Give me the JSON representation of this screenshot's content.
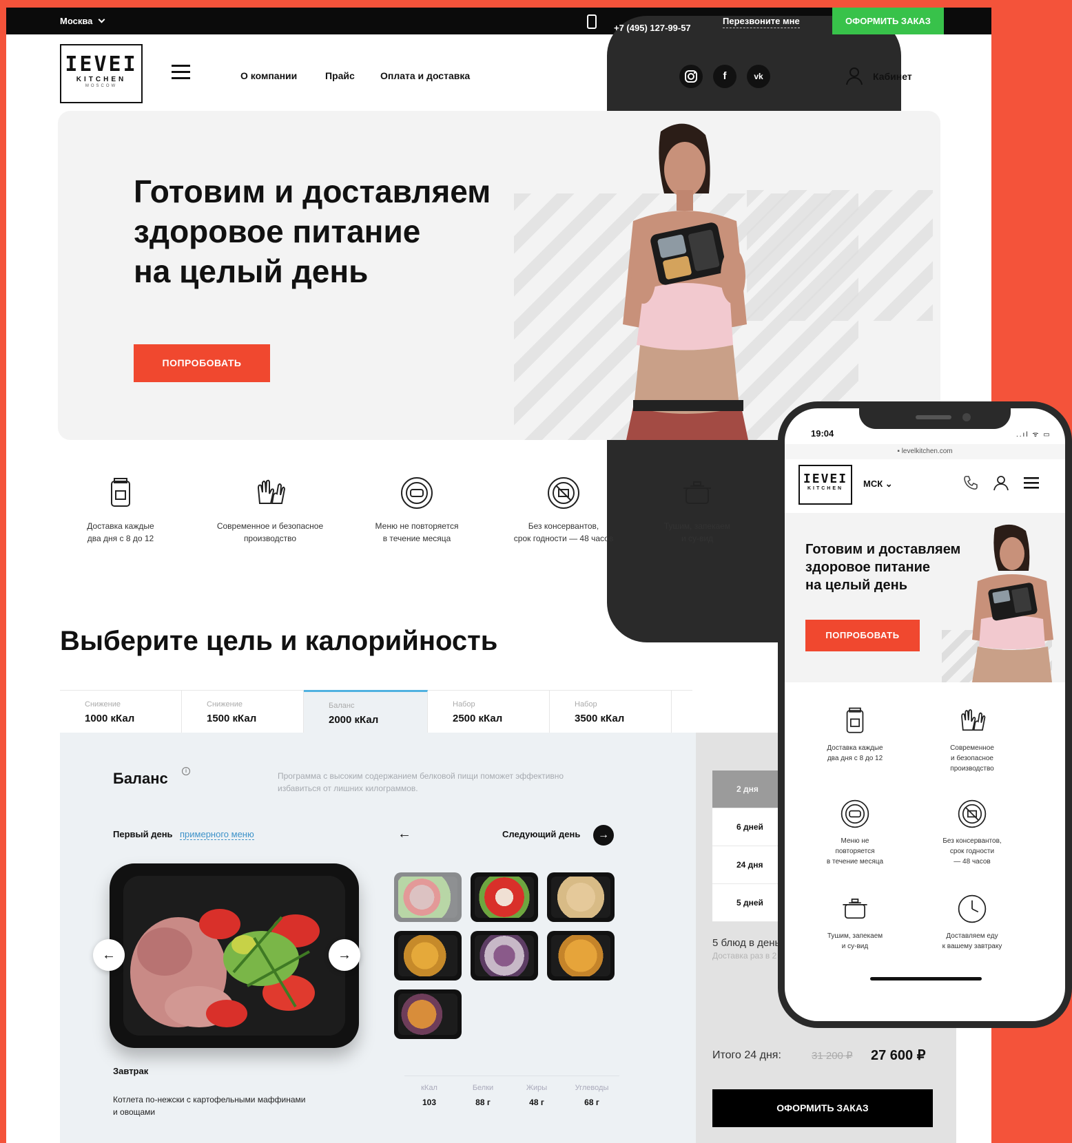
{
  "topbar": {
    "city": "Москва",
    "phone": "+7 (495) 127-99-57",
    "callback": "Перезвоните мне",
    "order": "ОФОРМИТЬ ЗАКАЗ"
  },
  "logo": {
    "line1": "IEVEI",
    "line2": "KITCHEN",
    "line3": "MOSCOW"
  },
  "nav": {
    "items": [
      "О компании",
      "Прайс",
      "Оплата и доставка"
    ]
  },
  "social": {
    "instagram": "instagram-icon",
    "facebook": "f",
    "vk": "vk"
  },
  "cabinet": "Кабинет",
  "hero": {
    "title_lines": [
      "Готовим и доставляем",
      "здоровое питание",
      "на целый день"
    ],
    "cta": "ПОПРОБОВАТЬ"
  },
  "features": [
    {
      "icon": "delivery-bag-icon",
      "text": [
        "Доставка каждые",
        "два дня с 8 до 12"
      ]
    },
    {
      "icon": "gloves-icon",
      "text": [
        "Современное и безопасное",
        "производство"
      ]
    },
    {
      "icon": "menu-plate-icon",
      "text": [
        "Меню не повторяется",
        "в течение месяца"
      ]
    },
    {
      "icon": "no-preservatives-icon",
      "text": [
        "Без консервантов,",
        "срок годности — 48 часов"
      ]
    },
    {
      "icon": "pot-icon",
      "text": [
        "Тушим, запекаем",
        "и су-вид"
      ]
    }
  ],
  "goal_section": {
    "title": "Выберите цель и калорийность",
    "tabs": [
      {
        "category": "Снижение",
        "kcal": "1000 кКал"
      },
      {
        "category": "Снижение",
        "kcal": "1500 кКал"
      },
      {
        "category": "Баланс",
        "kcal": "2000 кКал"
      },
      {
        "category": "Набор",
        "kcal": "2500 кКал"
      },
      {
        "category": "Набор",
        "kcal": "3500 кКал"
      }
    ],
    "active_tab": 2
  },
  "plan": {
    "title": "Баланс",
    "info": "i",
    "description": "Программа с высоким содержанием белковой пищи поможет эффективно избавиться от лишних килограммов.",
    "first_day": "Первый день",
    "menu_link": "примерного меню",
    "prev_arrow": "←",
    "next_day": "Следующий день",
    "next_arrow": "→",
    "carousel_prev": "←",
    "carousel_next": "→",
    "meal_name": "Завтрак",
    "meal_desc": "Котлета по-нежски с картофельными маффинами и овощами",
    "nutrition": [
      {
        "label": "кКал",
        "value": "103"
      },
      {
        "label": "Белки",
        "value": "88 г"
      },
      {
        "label": "Жиры",
        "value": "48 г"
      },
      {
        "label": "Углеводы",
        "value": "68 г"
      }
    ]
  },
  "order_side": {
    "days": [
      "2 дня",
      "6 дней",
      "24 дня",
      "5 дней"
    ],
    "selected_day": 0,
    "dishes": "5 блюд в день",
    "delivery_note": "Доставка раз в 2 дня",
    "total_label": "Итого 24 дня:",
    "old_price": "31 200 ₽",
    "new_price": "27 600 ₽",
    "order_button": "ОФОРМИТЬ ЗАКАЗ"
  },
  "mobile": {
    "time": "19:04",
    "status": "..ıl ᯤ ▭",
    "url": "levelkitchen.com",
    "city": "МСК",
    "hero_lines": [
      "Готовим и доставляем",
      "здоровое питание",
      "на целый день"
    ],
    "cta": "ПОПРОБОВАТЬ",
    "features": [
      {
        "icon": "delivery-bag-icon",
        "text": [
          "Доставка каждые",
          "два дня с 8 до 12"
        ]
      },
      {
        "icon": "gloves-icon",
        "text": [
          "Современное",
          "и безопасное",
          "производство"
        ]
      },
      {
        "icon": "menu-plate-icon",
        "text": [
          "Меню не",
          "повторяется",
          "в течение месяца"
        ]
      },
      {
        "icon": "no-preservatives-icon",
        "text": [
          "Без консервантов,",
          "срок годности",
          "— 48 часов"
        ]
      },
      {
        "icon": "pot-icon",
        "text": [
          "Тушим, запекаем",
          "и су-вид"
        ]
      },
      {
        "icon": "clock-icon",
        "text": [
          "Доставляем еду",
          "к вашему завтраку"
        ]
      }
    ]
  },
  "colors": {
    "accent": "#f0482f",
    "green": "#38c24a",
    "link": "#3d92c9",
    "background": "#f4533a"
  }
}
